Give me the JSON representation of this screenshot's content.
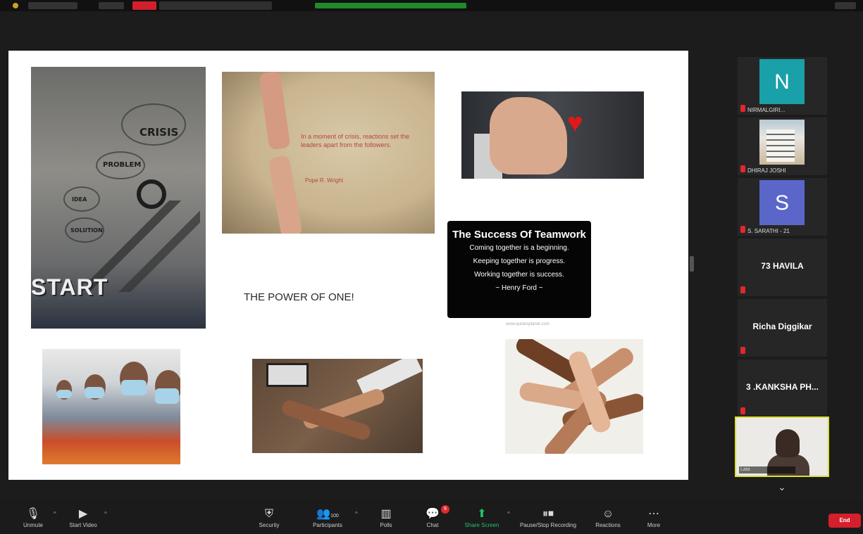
{
  "slide": {
    "crisis_words": [
      "CRISIS",
      "PROBLEM",
      "IDEA",
      "SOLUTION",
      "START"
    ],
    "hands_quote": "In a moment of crisis, reactions set the leaders apart from the followers.",
    "hands_author": "Pope R. Wright",
    "power_text": "THE POWER OF ONE!",
    "teamwork_title": "The Success Of Teamwork",
    "teamwork_lines": [
      "Coming together is a beginning.",
      "Keeping together is progress.",
      "Working together is success.",
      "~ Henry Ford ~"
    ],
    "teamwork_credit": "www.quotesplanet.com"
  },
  "participants": [
    {
      "initial": "N",
      "name": "NIRMALGIRI...",
      "color": "#1aa0a8"
    },
    {
      "initial": "",
      "name": "DHIRAJ JOSHI"
    },
    {
      "initial": "S",
      "name": "S. SARATHI - 21",
      "color": "#5a67c9"
    },
    {
      "name": "73 HAVILA"
    },
    {
      "name": "Richa Diggikar"
    },
    {
      "name": "3 .KANKSHA PH..."
    }
  ],
  "self_view": {
    "name": "Lata"
  },
  "toolbar": {
    "unmute": "Unmute",
    "start_video": "Start Video",
    "security": "Security",
    "participants": "Participants",
    "participants_count": "100",
    "polls": "Polls",
    "chat": "Chat",
    "chat_badge": "9",
    "share_screen": "Share Screen",
    "pause_recording": "Pause/Stop Recording",
    "reactions": "Reactions",
    "more": "More",
    "end": "End"
  },
  "colors": {
    "accent_green": "#21c26a",
    "end_red": "#d3202b",
    "active_speaker": "#d9e03a"
  }
}
